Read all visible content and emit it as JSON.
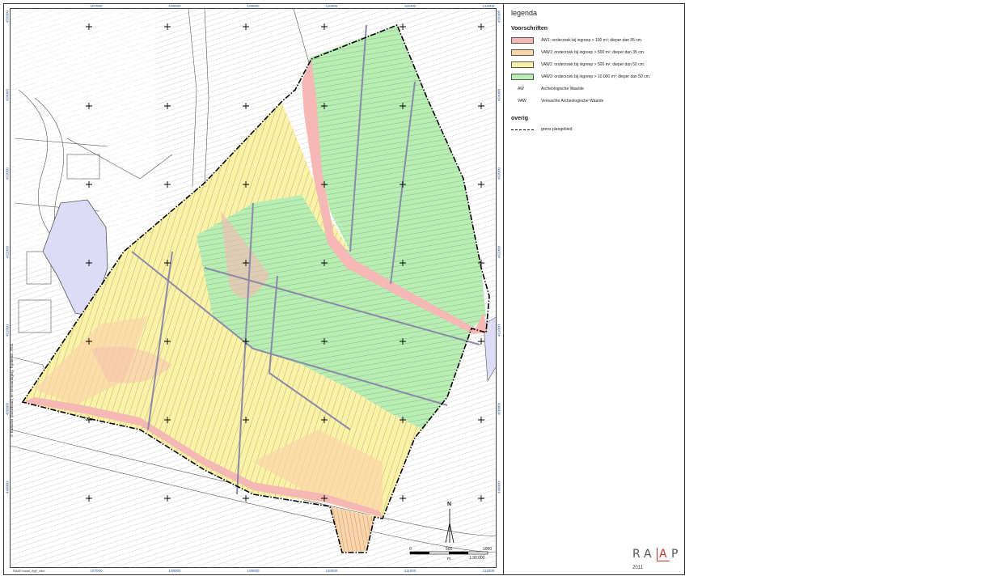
{
  "legend": {
    "title": "legenda",
    "voorschriften_heading": "Voorschriften",
    "items": [
      {
        "label": "AW1: onderzoek bij ingreep > 100 m²; dieper dan 35 cm.",
        "color": "#f6b8b4"
      },
      {
        "label": "VAW1: onderzoek bij ingreep > 500 m²; dieper dan 35 cm.",
        "color": "#fbd4a8"
      },
      {
        "label": "VAW2: onderzoek bij ingreep > 500 m²; dieper dan 50 cm.",
        "color": "#fbf2a6"
      },
      {
        "label": "VAW3: onderzoek bij ingreep > 10.000 m²; dieper dan 50 cm.",
        "color": "#b8eeb4"
      }
    ],
    "abbreviations": [
      {
        "abbr": "AW",
        "meaning": "Archeologische Waarde"
      },
      {
        "abbr": "VAW",
        "meaning": "Verwachte Archeologische Waarde"
      }
    ],
    "overig_heading": "overig",
    "boundary_label": "grens plangebied"
  },
  "coordinates": {
    "x": [
      "107000",
      "108000",
      "109000",
      "110000",
      "111000",
      "112000"
    ],
    "y": [
      "455000",
      "454000",
      "453000",
      "452000",
      "451000",
      "450000",
      "449000",
      "448000"
    ]
  },
  "scale": {
    "ratio": "1:30.000",
    "ticks": [
      "0",
      "500",
      "1000"
    ],
    "unit": "m"
  },
  "north": "N",
  "brand": {
    "letters": [
      "R",
      "A",
      "A",
      "P"
    ],
    "year": "2011"
  },
  "copyright": "© Kadaster (basiskaart) en vervaardiging: Topdienst, 2011",
  "file_id": "RAAP-kaart_fig9_vdw",
  "colors": {
    "aw1": "#f6b8b4",
    "vaw1": "#fbd4a8",
    "vaw2": "#fbf2a6",
    "vaw3": "#b8eeb4",
    "water": "#dcdcf6",
    "coord_text": "#2a5a9a"
  }
}
